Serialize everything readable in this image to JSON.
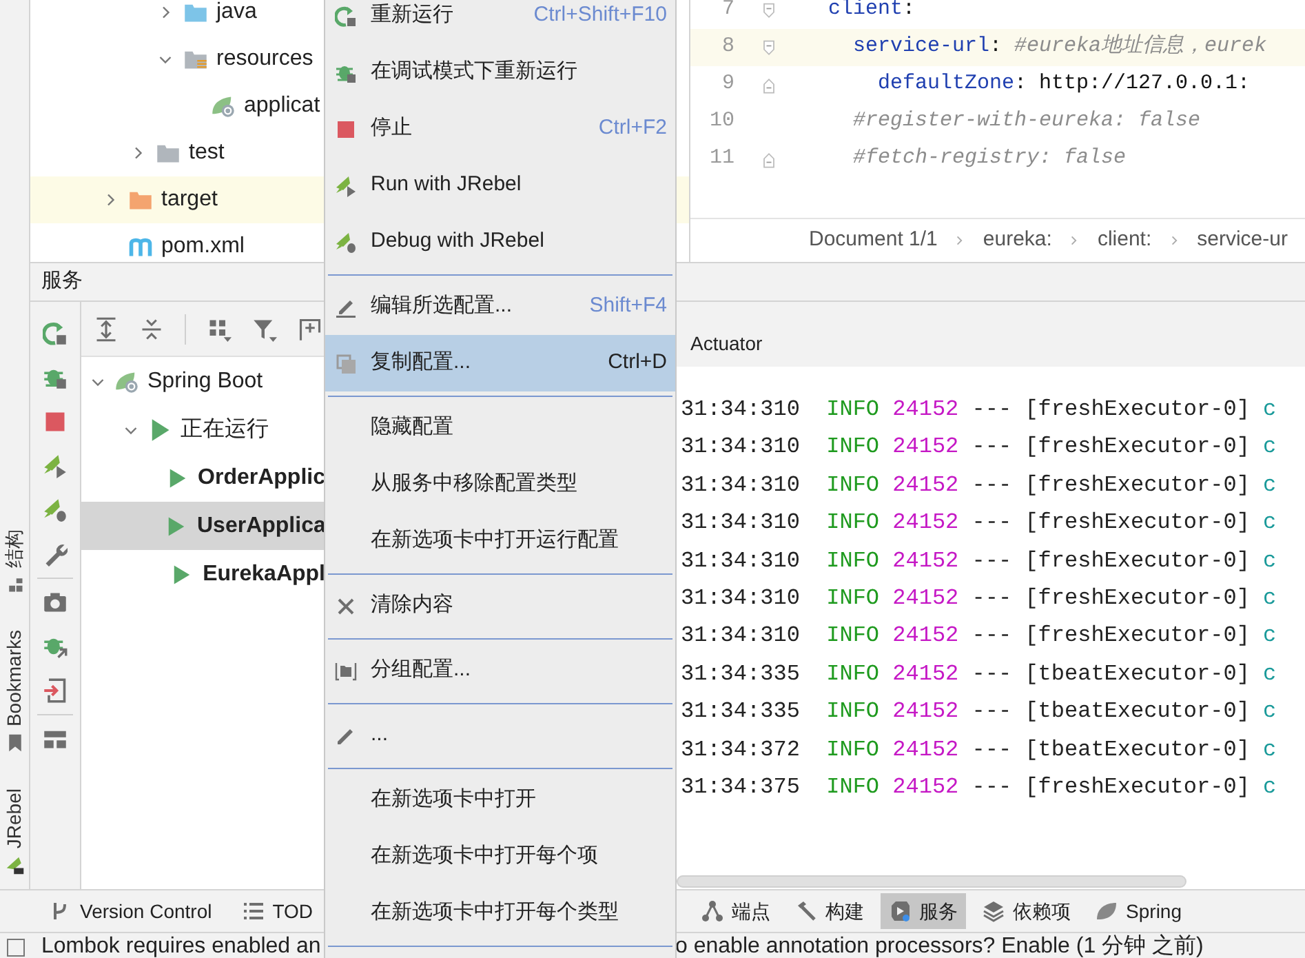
{
  "tool_stripes": [
    {
      "label": "结构"
    },
    {
      "label": "Bookmarks"
    },
    {
      "label": "JRebel"
    }
  ],
  "project_tree": [
    {
      "children": [
        {
          "children": [
            {
              "label": "java",
              "kind": "source-folder",
              "expanded": false,
              "highlighted": false
            },
            {
              "label": "resources",
              "kind": "resources-folder",
              "expanded": true,
              "highlighted": false,
              "children": [
                {
                  "label": "applicat",
                  "kind": "spring-config",
                  "highlighted": false
                }
              ]
            }
          ]
        },
        {
          "label": "test",
          "kind": "folder",
          "expanded": false,
          "highlighted": false
        }
      ]
    },
    {
      "label": "target",
      "kind": "excluded-folder",
      "expanded": false,
      "highlighted": true
    },
    {
      "label": "pom.xml",
      "kind": "maven-file",
      "highlighted": false
    }
  ],
  "editor": {
    "lines": [
      {
        "number": "7",
        "current": false,
        "segments": [
          {
            "kind": "key",
            "text": "  client"
          },
          {
            "kind": "plain",
            "text": ":"
          }
        ]
      },
      {
        "number": "8",
        "current": true,
        "segments": [
          {
            "kind": "key",
            "text": "    service-url"
          },
          {
            "kind": "plain",
            "text": ": "
          },
          {
            "kind": "comment",
            "text": "#eureka地址信息，eurek"
          }
        ]
      },
      {
        "number": "9",
        "current": false,
        "segments": [
          {
            "kind": "key",
            "text": "      defaultZone"
          },
          {
            "kind": "plain",
            "text": ": http://127.0.0.1:"
          }
        ]
      },
      {
        "number": "10",
        "current": false,
        "segments": [
          {
            "kind": "comment",
            "text": "    #register-with-eureka: false"
          }
        ]
      },
      {
        "number": "11",
        "current": false,
        "segments": [
          {
            "kind": "comment",
            "text": "    #fetch-registry: false"
          }
        ]
      }
    ],
    "breadcrumbs": [
      "Document 1/1",
      "eureka:",
      "client:",
      "service-ur"
    ]
  },
  "services": {
    "title": "服务",
    "tree": [
      {
        "label": "Spring Boot",
        "kind": "spring",
        "expanded": true,
        "selected": false,
        "children": [
          {
            "label": "正在运行",
            "kind": "group",
            "expanded": true,
            "selected": false,
            "children": [
              {
                "label": "OrderApplic",
                "kind": "app",
                "selected": false
              },
              {
                "label": "UserApplica",
                "kind": "app",
                "selected": true
              },
              {
                "label": "EurekaAppl",
                "kind": "app",
                "selected": false
              }
            ]
          }
        ]
      }
    ],
    "tab": "Actuator",
    "console": [
      {
        "time": "31:34:310",
        "level": "INFO",
        "pid": "24152",
        "sep": "---",
        "thread": "[freshExecutor-0]",
        "logger": "c"
      },
      {
        "time": "31:34:310",
        "level": "INFO",
        "pid": "24152",
        "sep": "---",
        "thread": "[freshExecutor-0]",
        "logger": "c"
      },
      {
        "time": "31:34:310",
        "level": "INFO",
        "pid": "24152",
        "sep": "---",
        "thread": "[freshExecutor-0]",
        "logger": "c"
      },
      {
        "time": "31:34:310",
        "level": "INFO",
        "pid": "24152",
        "sep": "---",
        "thread": "[freshExecutor-0]",
        "logger": "c"
      },
      {
        "time": "31:34:310",
        "level": "INFO",
        "pid": "24152",
        "sep": "---",
        "thread": "[freshExecutor-0]",
        "logger": "c"
      },
      {
        "time": "31:34:310",
        "level": "INFO",
        "pid": "24152",
        "sep": "---",
        "thread": "[freshExecutor-0]",
        "logger": "c"
      },
      {
        "time": "31:34:310",
        "level": "INFO",
        "pid": "24152",
        "sep": "---",
        "thread": "[freshExecutor-0]",
        "logger": "c"
      },
      {
        "time": "31:34:335",
        "level": "INFO",
        "pid": "24152",
        "sep": "---",
        "thread": "[tbeatExecutor-0]",
        "logger": "c"
      },
      {
        "time": "31:34:335",
        "level": "INFO",
        "pid": "24152",
        "sep": "---",
        "thread": "[tbeatExecutor-0]",
        "logger": "c"
      },
      {
        "time": "31:34:372",
        "level": "INFO",
        "pid": "24152",
        "sep": "---",
        "thread": "[tbeatExecutor-0]",
        "logger": "c"
      },
      {
        "time": "31:34:375",
        "level": "INFO",
        "pid": "24152",
        "sep": "---",
        "thread": "[freshExecutor-0]",
        "logger": "c"
      }
    ]
  },
  "tool_tabs": [
    {
      "label": "Version Control",
      "selected": false
    },
    {
      "label": "TOD",
      "selected": false
    },
    {
      "label": "端点",
      "selected": false
    },
    {
      "label": "构建",
      "selected": false
    },
    {
      "label": "服务",
      "selected": true
    },
    {
      "label": "依赖项",
      "selected": false
    },
    {
      "label": "Spring",
      "selected": false
    }
  ],
  "status_bar": {
    "checkbox": {
      "checked": false
    },
    "messages": [
      "Lombok requires enabled an",
      "o enable annotation processors? Enable (1 分钟 之前)"
    ]
  },
  "context_menu": [
    {
      "kind": "item",
      "label": "重新运行",
      "shortcut": "Ctrl+Shift+F10",
      "selected": false
    },
    {
      "kind": "item",
      "label": "在调试模式下重新运行",
      "selected": false
    },
    {
      "kind": "item",
      "label": "停止",
      "shortcut": "Ctrl+F2",
      "selected": false
    },
    {
      "kind": "item",
      "label": "Run with JRebel",
      "selected": false
    },
    {
      "kind": "item",
      "label": "Debug with JRebel",
      "selected": false
    },
    {
      "kind": "separator"
    },
    {
      "kind": "item",
      "label": "编辑所选配置...",
      "shortcut": "Shift+F4",
      "selected": false
    },
    {
      "kind": "item",
      "label": "复制配置...",
      "shortcut": "Ctrl+D",
      "selected": true
    },
    {
      "kind": "separator"
    },
    {
      "kind": "item",
      "label": "隐藏配置",
      "selected": false
    },
    {
      "kind": "item",
      "label": "从服务中移除配置类型",
      "selected": false
    },
    {
      "kind": "item",
      "label": "在新选项卡中打开运行配置",
      "selected": false
    },
    {
      "kind": "separator"
    },
    {
      "kind": "item",
      "label": "清除内容",
      "selected": false
    },
    {
      "kind": "separator"
    },
    {
      "kind": "item",
      "label": "分组配置...",
      "selected": false
    },
    {
      "kind": "separator"
    },
    {
      "kind": "item",
      "label": "...",
      "selected": false
    },
    {
      "kind": "separator"
    },
    {
      "kind": "item",
      "label": "在新选项卡中打开",
      "selected": false
    },
    {
      "kind": "item",
      "label": "在新选项卡中打开每个项",
      "selected": false
    },
    {
      "kind": "item",
      "label": "在新选项卡中打开每个类型",
      "selected": false
    },
    {
      "kind": "separator"
    }
  ]
}
